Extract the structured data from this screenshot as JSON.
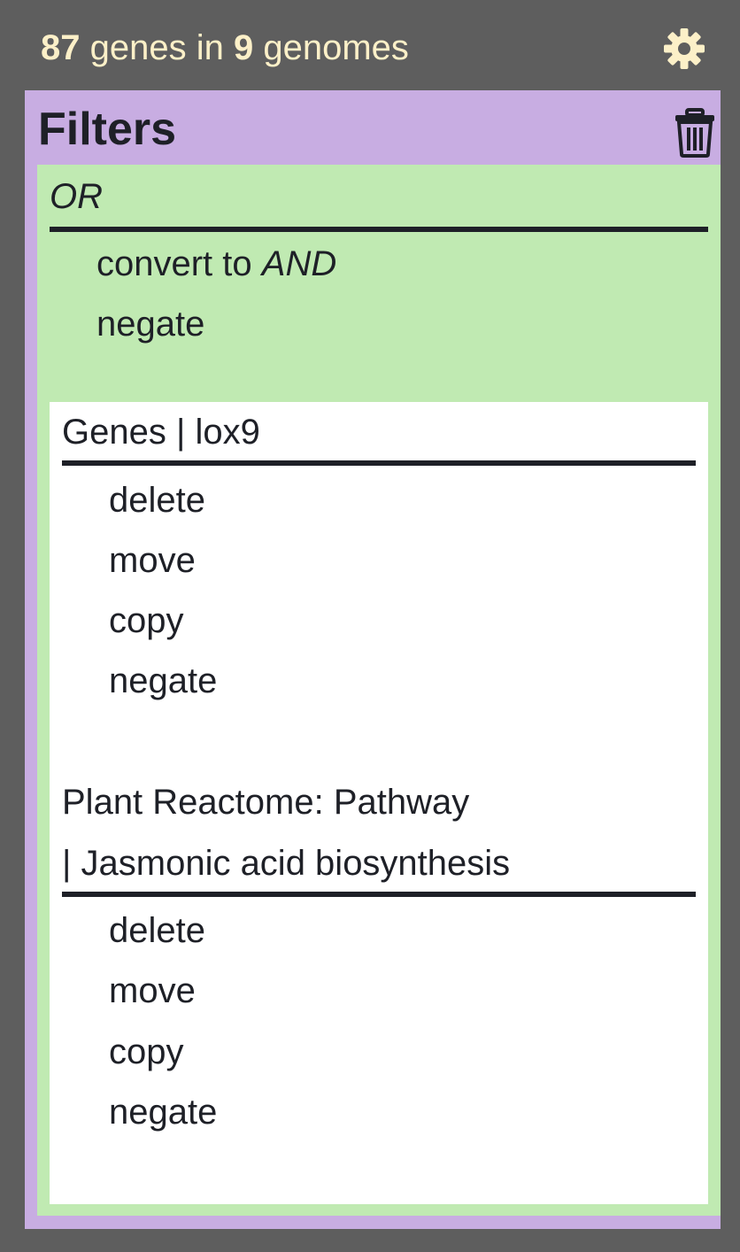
{
  "header": {
    "gene_count": "87",
    "genes_label": " genes in ",
    "genome_count": "9",
    "genomes_label": " genomes",
    "settings_icon": "gear-icon"
  },
  "filters": {
    "title": "Filters",
    "clear_icon": "trash-icon",
    "group": {
      "operator": "OR",
      "convert_prefix": "convert to ",
      "convert_target": "AND",
      "negate_label": "negate",
      "items": [
        {
          "title_line1": "Genes | lox9",
          "actions": [
            "delete",
            "move",
            "copy",
            "negate"
          ]
        },
        {
          "title_line1": "Plant Reactome: Pathway",
          "title_line2": "| Jasmonic acid biosynthesis",
          "actions": [
            "delete",
            "move",
            "copy",
            "negate"
          ]
        }
      ]
    }
  },
  "colors": {
    "background": "#5e5e5e",
    "header_text": "#fcf0c8",
    "filters_panel": "#c8ade2",
    "or_group": "#c0eab2",
    "filter_box": "#ffffff",
    "text": "#1e2027"
  }
}
